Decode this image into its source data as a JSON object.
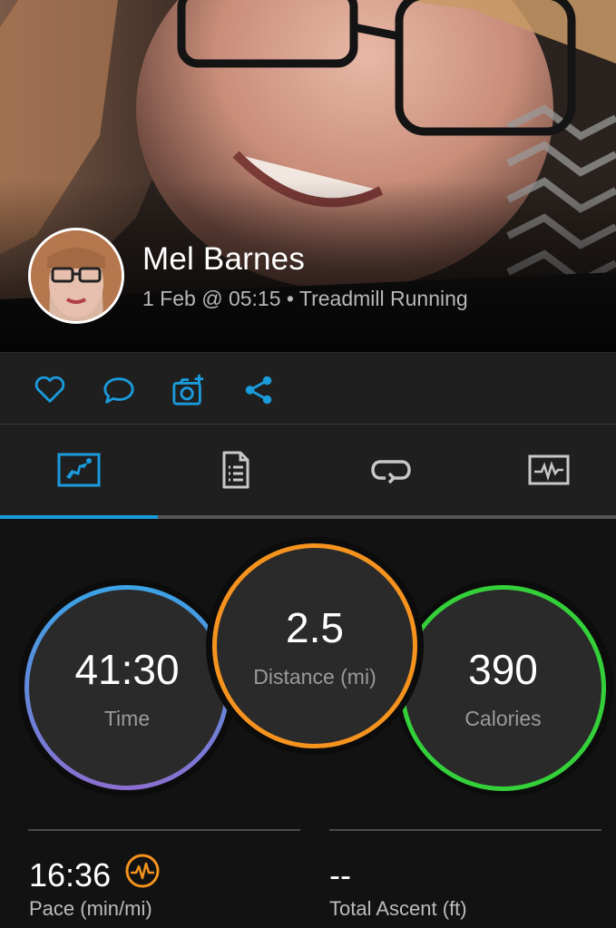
{
  "header": {
    "user_name": "Mel Barnes",
    "activity_meta": "1 Feb @ 05:15 • Treadmill Running"
  },
  "actions": [
    {
      "icon": "heart-icon"
    },
    {
      "icon": "comment-icon"
    },
    {
      "icon": "add-photo-icon"
    },
    {
      "icon": "share-icon"
    }
  ],
  "tabs": [
    {
      "icon": "summary-icon",
      "selected": true
    },
    {
      "icon": "details-icon",
      "selected": false
    },
    {
      "icon": "laps-icon",
      "selected": false
    },
    {
      "icon": "charts-icon",
      "selected": false
    }
  ],
  "stats": {
    "time": {
      "value": "41:30",
      "label": "Time"
    },
    "distance": {
      "value": "2.5",
      "label": "Distance (mi)"
    },
    "calories": {
      "value": "390",
      "label": "Calories"
    }
  },
  "metrics": {
    "pace": {
      "value": "16:36",
      "label": "Pace (min/mi)"
    },
    "ascent": {
      "value": "--",
      "label": "Total Ascent (ft)"
    }
  },
  "colors": {
    "accent": "#1a9bdc",
    "time_ring_top": "#3aa3e6",
    "time_ring_bottom": "#8a6fd0",
    "distance_ring": "#f5931e",
    "calories_ring": "#34d03a",
    "pace_icon": "#f5931e"
  }
}
